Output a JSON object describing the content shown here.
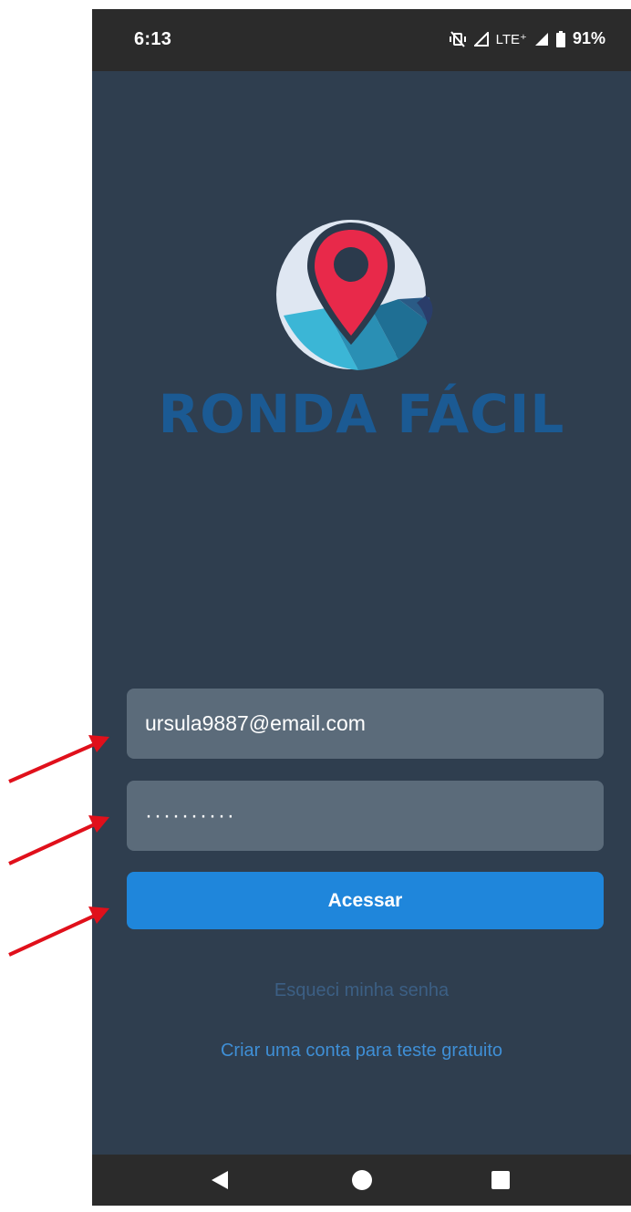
{
  "status_bar": {
    "time": "6:13",
    "network": "LTE⁺",
    "battery": "91%",
    "icons": [
      "vibrate-off-icon",
      "signal-icon",
      "signal-icon",
      "battery-icon"
    ]
  },
  "logo": {
    "text": "RONDA FÁCIL",
    "colors": {
      "pin": "#e8294a",
      "globe": "#dfe7f2",
      "teal": "#3bb6d6",
      "text": "#1b5a93"
    }
  },
  "login": {
    "email_value": "ursula9887@email.com",
    "password_value": "··········",
    "access_button": "Acessar",
    "forgot_link": "Esqueci minha senha",
    "create_account_link": "Criar uma conta para teste gratuito"
  },
  "nav_bar": {
    "icons": [
      "back-icon",
      "home-icon",
      "recents-icon"
    ]
  },
  "colors": {
    "background": "#2f3e4f",
    "field": "#5b6b7a",
    "button": "#1f86db",
    "annotation_arrow": "#e0101b"
  }
}
